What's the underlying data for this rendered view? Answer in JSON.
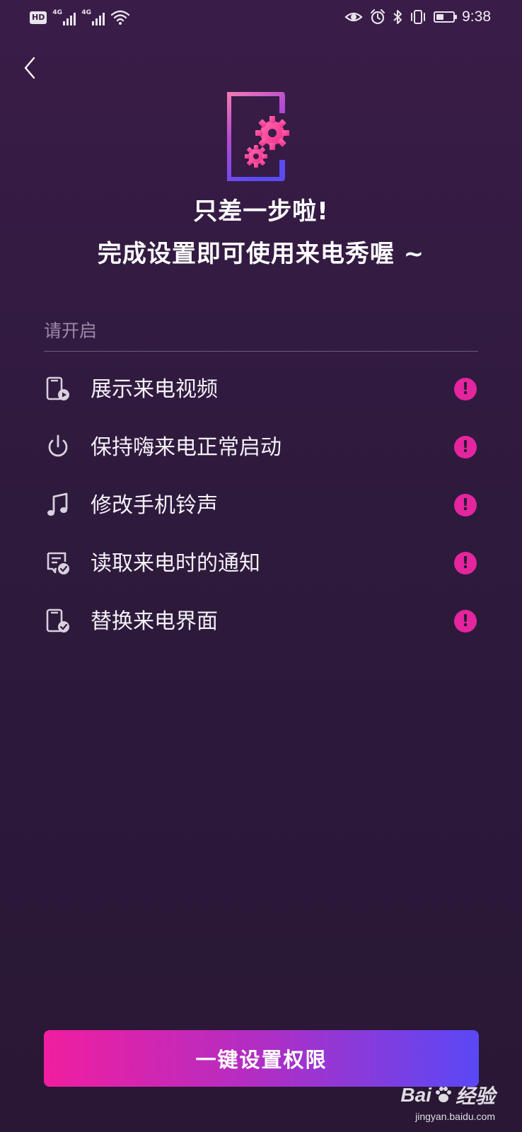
{
  "status_bar": {
    "hd_label": "HD",
    "sim1_label": "4G",
    "sim2_label": "4G",
    "battery_level": 0.45,
    "time": "9:38"
  },
  "header": {
    "title": "只差一步啦!",
    "subtitle": "完成设置即可使用来电秀喔 ~"
  },
  "permissions": {
    "section_label": "请开启",
    "items": [
      {
        "label": "展示来电视频",
        "icon": "phone-video-icon"
      },
      {
        "label": "保持嗨来电正常启动",
        "icon": "power-icon"
      },
      {
        "label": "修改手机铃声",
        "icon": "music-note-icon"
      },
      {
        "label": "读取来电时的通知",
        "icon": "notification-check-icon"
      },
      {
        "label": "替换来电界面",
        "icon": "phone-check-icon"
      }
    ],
    "status_icon": "alert-icon",
    "status_glyph": "!"
  },
  "cta": {
    "label": "一键设置权限"
  },
  "watermark": {
    "brand_left": "Bai",
    "brand_right": "经验",
    "site": "jingyan.baidu.com"
  },
  "colors": {
    "background_top": "#3a1c48",
    "background_bottom": "#291735",
    "accent_pink": "#e4259e",
    "cta_start": "#f11e9f",
    "cta_end": "#5a48f6"
  }
}
